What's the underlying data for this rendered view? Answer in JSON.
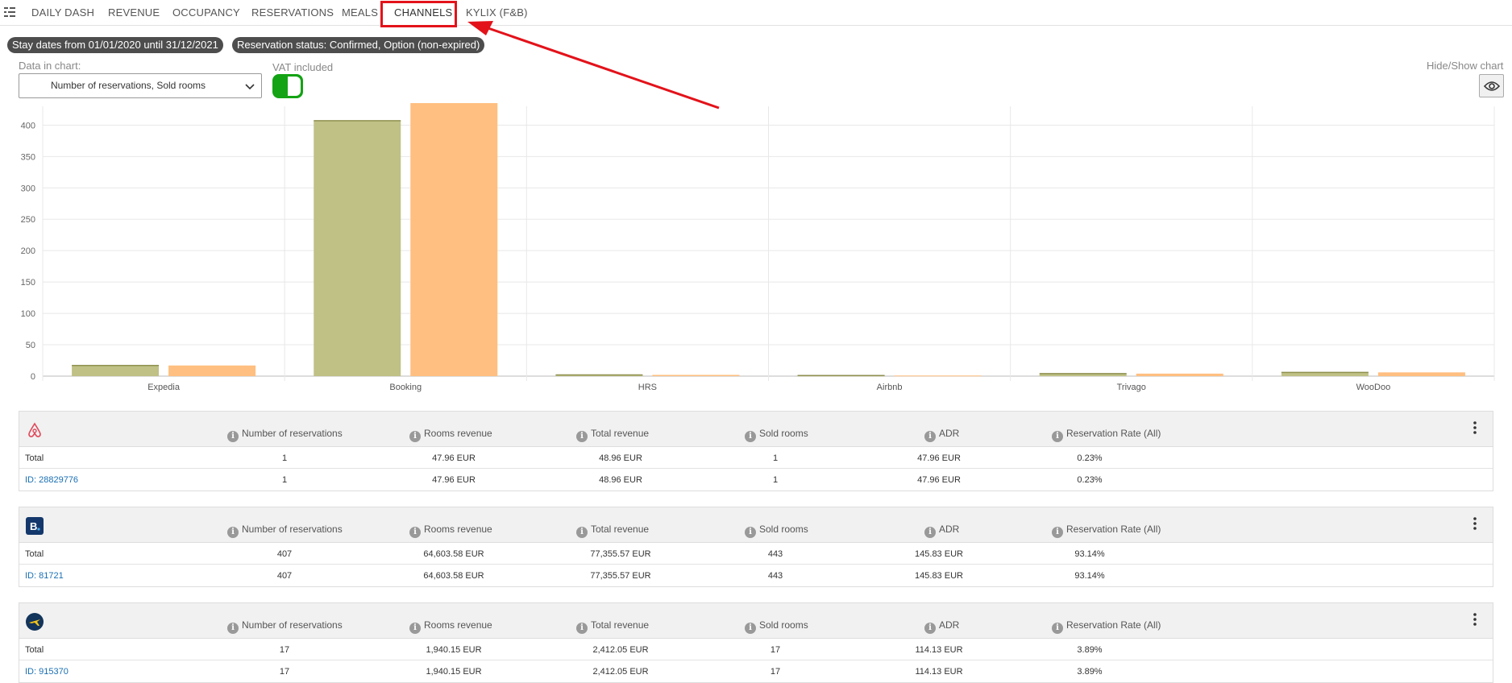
{
  "nav": {
    "tabs": [
      {
        "label": "DAILY DASH"
      },
      {
        "label": "REVENUE"
      },
      {
        "label": "OCCUPANCY"
      },
      {
        "label": "RESERVATIONS"
      },
      {
        "label": "MEALS"
      },
      {
        "label": "CHANNELS",
        "active": true
      },
      {
        "label": "KYLIX (F&B)"
      }
    ]
  },
  "filters": {
    "stay_dates": "Stay dates from 01/01/2020 until 31/12/2021",
    "reservation_status": "Reservation status: Confirmed, Option (non-expired)"
  },
  "controls": {
    "data_in_chart_label": "Data in chart:",
    "data_in_chart_value": "Number of reservations, Sold rooms",
    "vat_label": "VAT included",
    "vat_on": true,
    "hide_show_label": "Hide/Show chart"
  },
  "colors": {
    "series1": "#bfc185",
    "series2": "#ffbf80",
    "accent_red": "#e3121a",
    "toggle_green": "#13a314",
    "link": "#1a6fb3"
  },
  "chart_data": {
    "type": "bar",
    "categories": [
      "Expedia",
      "Booking",
      "HRS",
      "Airbnb",
      "Trivago",
      "WooDoo"
    ],
    "series": [
      {
        "values": [
          17,
          407,
          2,
          1,
          4,
          6
        ]
      },
      {
        "values": [
          17,
          443,
          2,
          1,
          4,
          6
        ]
      }
    ],
    "ylim": [
      0,
      430
    ],
    "yticks": [
      0,
      50,
      100,
      150,
      200,
      250,
      300,
      350,
      400
    ],
    "grid": true,
    "xlabel": "",
    "ylabel": "",
    "title": ""
  },
  "table": {
    "headers": [
      "Number of reservations",
      "Rooms revenue",
      "Total revenue",
      "Sold rooms",
      "ADR",
      "Reservation Rate (All)"
    ],
    "cards": [
      {
        "logo": "airbnb-icon",
        "rows": [
          {
            "label": "Total",
            "link": false,
            "values": [
              "1",
              "47.96 EUR",
              "48.96 EUR",
              "1",
              "47.96 EUR",
              "0.23%"
            ]
          },
          {
            "label": "ID: 28829776",
            "link": true,
            "values": [
              "1",
              "47.96 EUR",
              "48.96 EUR",
              "1",
              "47.96 EUR",
              "0.23%"
            ]
          }
        ]
      },
      {
        "logo": "booking-icon",
        "logo_text": "B.",
        "rows": [
          {
            "label": "Total",
            "link": false,
            "values": [
              "407",
              "64,603.58 EUR",
              "77,355.57 EUR",
              "443",
              "145.83 EUR",
              "93.14%"
            ]
          },
          {
            "label": "ID: 81721",
            "link": true,
            "values": [
              "407",
              "64,603.58 EUR",
              "77,355.57 EUR",
              "443",
              "145.83 EUR",
              "93.14%"
            ]
          }
        ]
      },
      {
        "logo": "expedia-icon",
        "rows": [
          {
            "label": "Total",
            "link": false,
            "values": [
              "17",
              "1,940.15 EUR",
              "2,412.05 EUR",
              "17",
              "114.13 EUR",
              "3.89%"
            ]
          },
          {
            "label": "ID: 915370",
            "link": true,
            "values": [
              "17",
              "1,940.15 EUR",
              "2,412.05 EUR",
              "17",
              "114.13 EUR",
              "3.89%"
            ]
          }
        ]
      }
    ]
  }
}
